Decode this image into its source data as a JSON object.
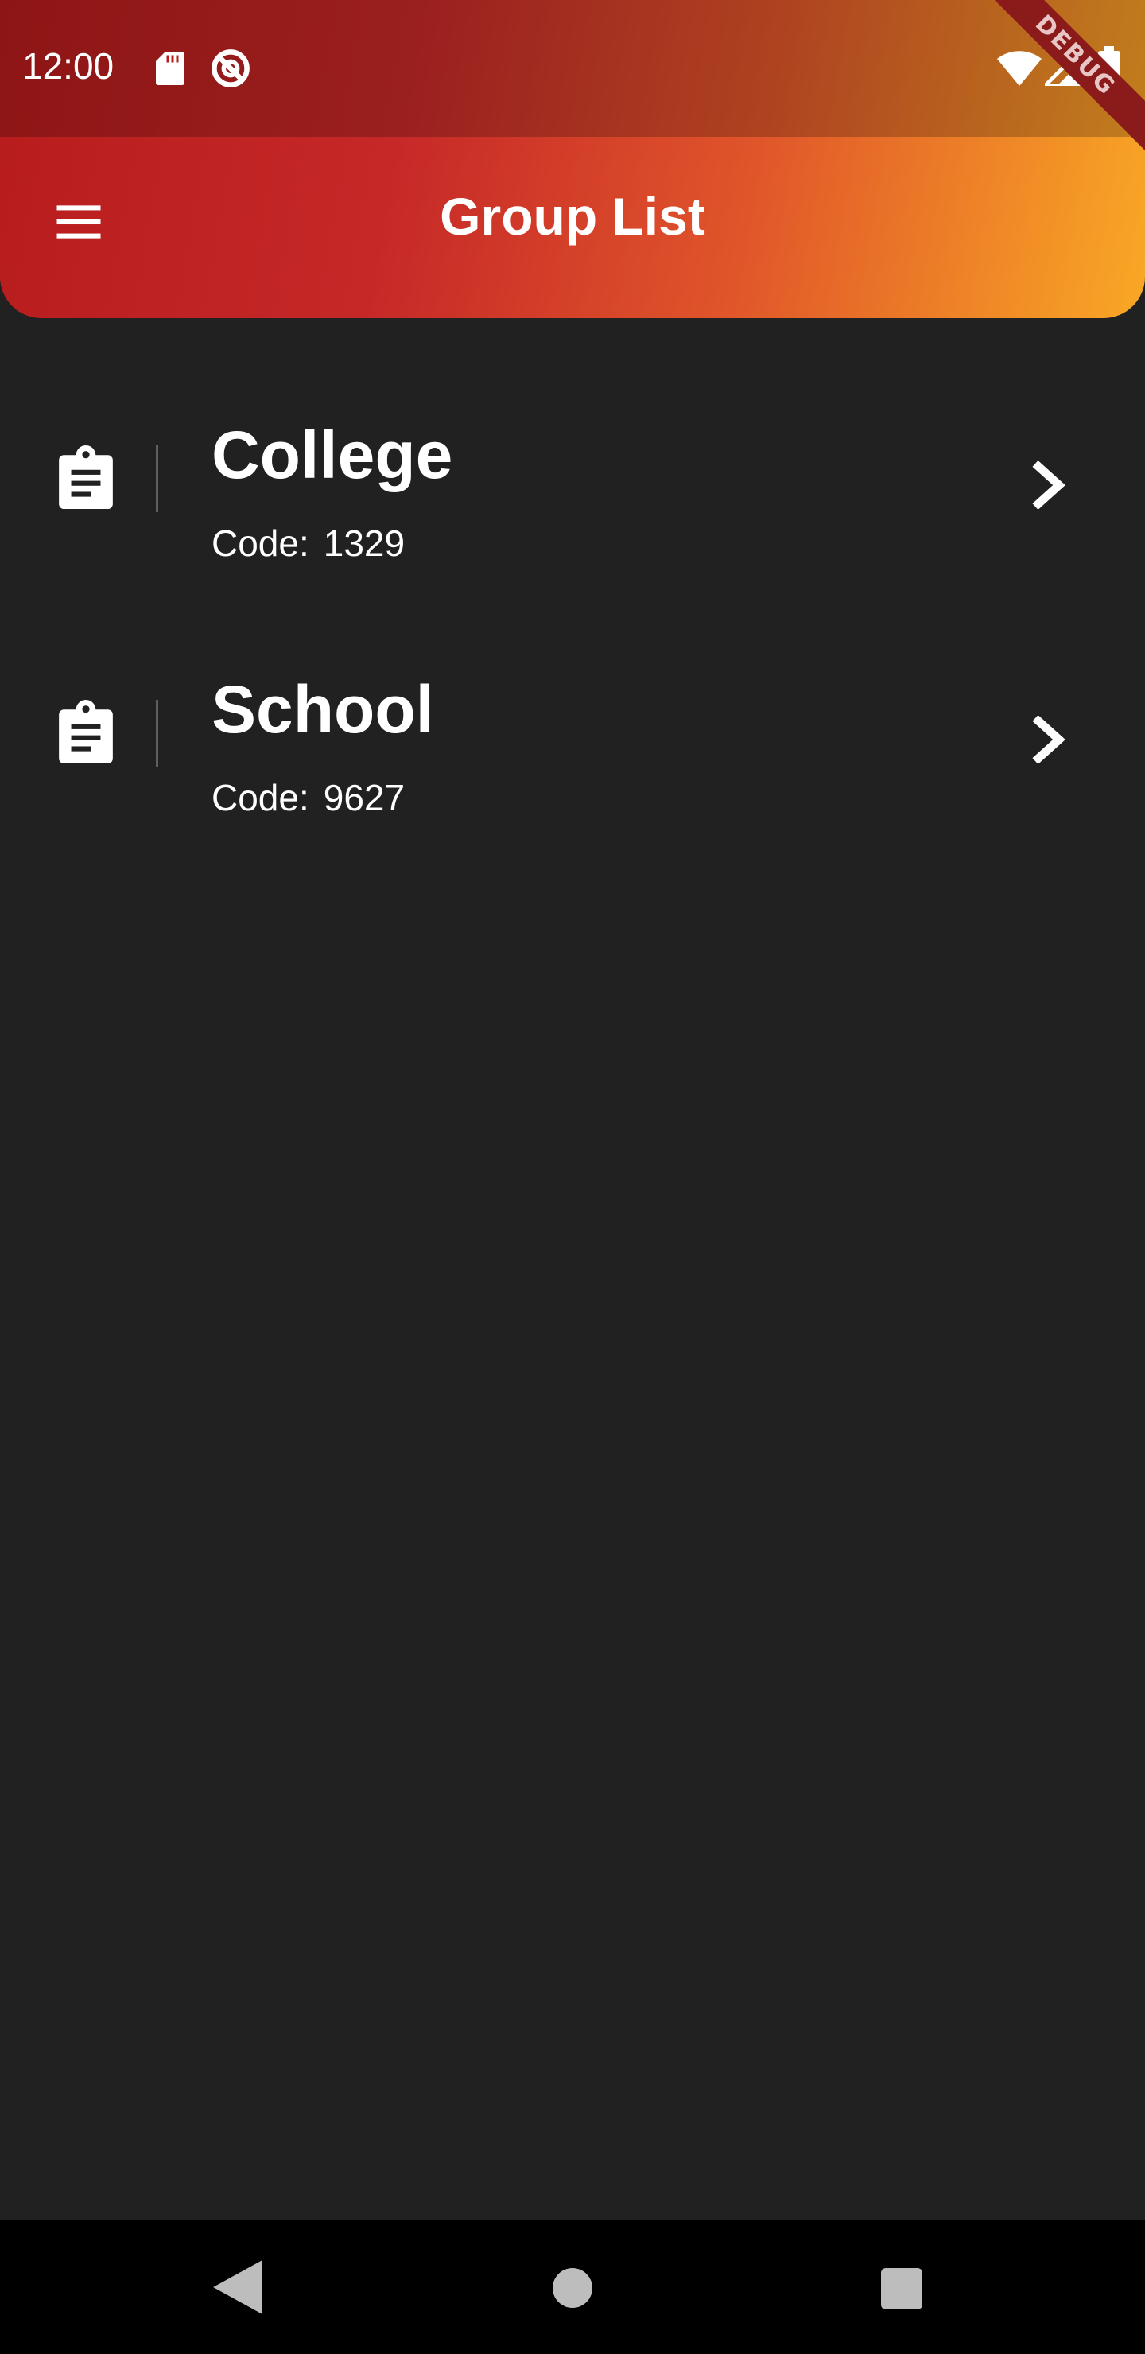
{
  "status_bar": {
    "time": "12:00",
    "icons": [
      "sd-card-icon",
      "sync-disabled-icon",
      "wifi-icon",
      "signal-icon",
      "battery-icon"
    ]
  },
  "debug_banner": "DEBUG",
  "app_bar": {
    "title": "Group List",
    "menu_icon": "menu-icon",
    "gradient": [
      "#b71c1c",
      "#c62828",
      "#e0552a",
      "#f9a825"
    ]
  },
  "groups": [
    {
      "name": "College",
      "code_label": "Code:",
      "code": "1329",
      "icon": "clipboard-icon",
      "trailing_icon": "chevron-right-icon"
    },
    {
      "name": "School",
      "code_label": "Code:",
      "code": "9627",
      "icon": "clipboard-icon",
      "trailing_icon": "chevron-right-icon"
    }
  ],
  "nav_bar": {
    "buttons": [
      "back-icon",
      "home-icon",
      "recents-icon"
    ]
  },
  "colors": {
    "background": "#212121",
    "text": "#ffffff",
    "nav_bar": "#000000"
  }
}
